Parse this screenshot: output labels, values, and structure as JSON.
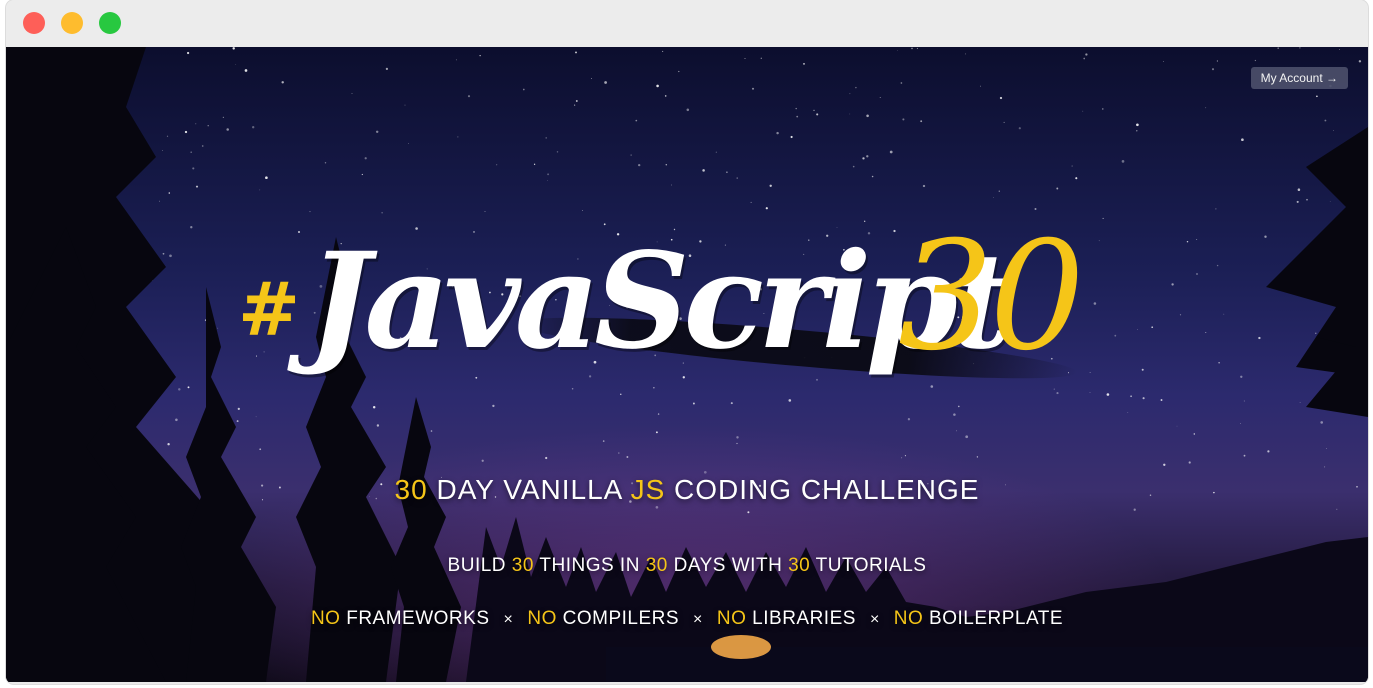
{
  "window": {
    "controls": [
      "close",
      "minimize",
      "maximize"
    ]
  },
  "header": {
    "account_label": "My Account →"
  },
  "logo": {
    "hash": "#",
    "word": "JavaScript",
    "number": "30"
  },
  "tagline": {
    "num": "30",
    "part1": " DAY VANILLA ",
    "js": "JS",
    "part2": " CODING CHALLENGE"
  },
  "subline": {
    "build": "BUILD ",
    "n1": "30",
    "things": " THINGS IN ",
    "n2": "30",
    "days": " DAYS WITH ",
    "n3": "30",
    "tutorials": " TUTORIALS"
  },
  "features": {
    "items": [
      {
        "no": "NO",
        "label": " FRAMEWORKS"
      },
      {
        "no": "NO",
        "label": " COMPILERS"
      },
      {
        "no": "NO",
        "label": " LIBRARIES"
      },
      {
        "no": "NO",
        "label": " BOILERPLATE"
      }
    ],
    "separator": "×"
  },
  "colors": {
    "accent": "#f5c518",
    "text": "#ffffff",
    "sky": "#1b1f55"
  }
}
